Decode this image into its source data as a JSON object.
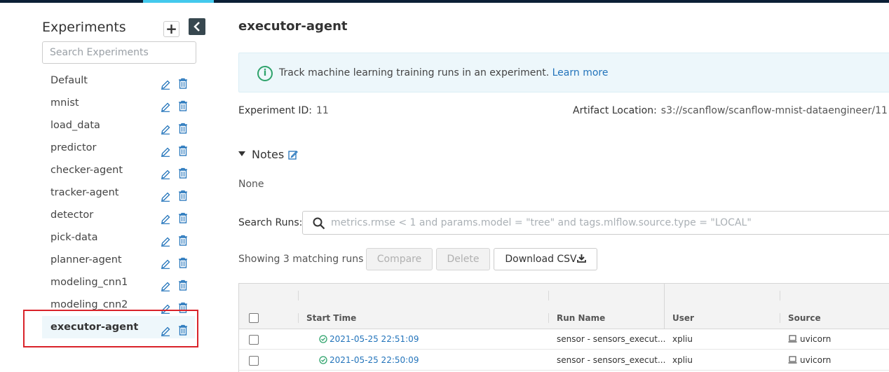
{
  "sidebar": {
    "title": "Experiments",
    "add_label": "+",
    "search_placeholder": "Search Experiments",
    "items": [
      {
        "label": "Default"
      },
      {
        "label": "mnist"
      },
      {
        "label": "load_data"
      },
      {
        "label": "predictor"
      },
      {
        "label": "checker-agent"
      },
      {
        "label": "tracker-agent"
      },
      {
        "label": "detector"
      },
      {
        "label": "pick-data"
      },
      {
        "label": "planner-agent"
      },
      {
        "label": "modeling_cnn1"
      },
      {
        "label": "modeling_cnn2"
      },
      {
        "label": "executor-agent"
      }
    ],
    "active_item": "executor-agent"
  },
  "main": {
    "title": "executor-agent",
    "info": {
      "icon": "i",
      "text": "Track machine learning training runs in an experiment.",
      "link": "Learn more"
    },
    "experiment_id_label": "Experiment ID:",
    "experiment_id": "11",
    "artifact_location_label": "Artifact Location:",
    "artifact_location": "s3://scanflow/scanflow-mnist-dataengineer/11",
    "notes_label": "Notes",
    "notes_value": "None",
    "search_runs_label": "Search Runs:",
    "search_runs_placeholder": "metrics.rmse < 1 and params.model = \"tree\" and tags.mlflow.source.type = \"LOCAL\"",
    "showing_text": "Showing 3 matching runs",
    "compare_label": "Compare",
    "delete_label": "Delete",
    "download_label": "Download CSV",
    "table": {
      "columns": [
        "Start Time",
        "Run Name",
        "User",
        "Source"
      ],
      "rows": [
        {
          "start_time": "2021-05-25 22:51:09",
          "run_name": "sensor - sensors_execut...",
          "user": "xpliu",
          "source": "uvicorn"
        },
        {
          "start_time": "2021-05-25 22:50:09",
          "run_name": "sensor - sensors_execut...",
          "user": "xpliu",
          "source": "uvicorn"
        }
      ]
    }
  },
  "colors": {
    "accent": "#43c9ed",
    "topbar": "#0b1f36",
    "highlight": "#d9232a",
    "link": "#2374bb",
    "success": "#2ea36b"
  }
}
